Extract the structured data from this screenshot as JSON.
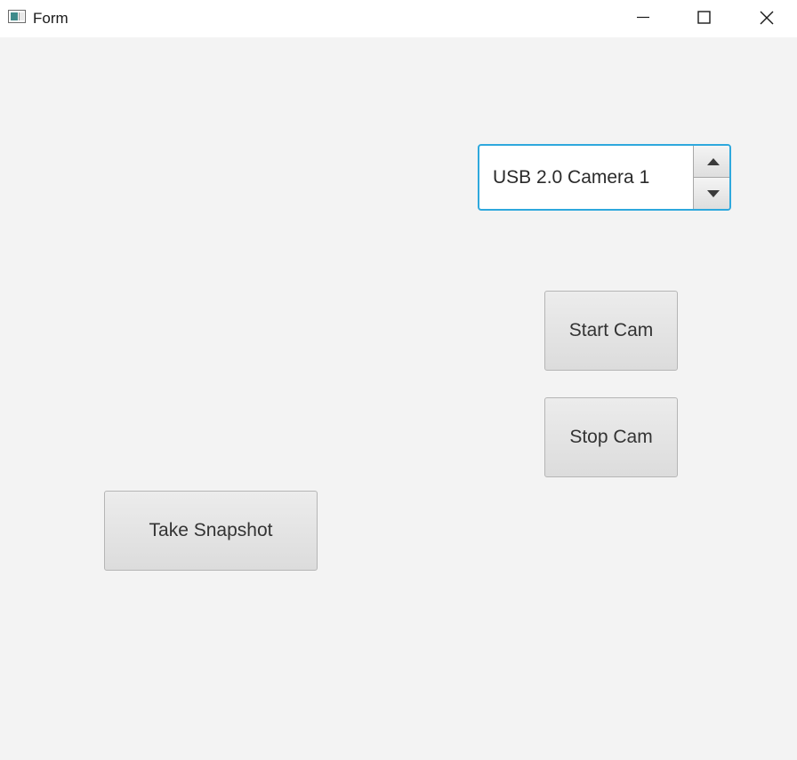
{
  "window": {
    "title": "Form",
    "icon": "window-app-icon",
    "controls": [
      "minimize-icon",
      "maximize-icon",
      "close-icon"
    ]
  },
  "camera_spinner": {
    "value": "USB 2.0 Camera 1",
    "increment_icon": "triangle-up-icon",
    "decrement_icon": "triangle-down-icon",
    "focus_color": "#2ea8dd"
  },
  "buttons": {
    "start_cam": "Start Cam",
    "stop_cam": "Stop Cam",
    "take_snapshot": "Take Snapshot"
  }
}
